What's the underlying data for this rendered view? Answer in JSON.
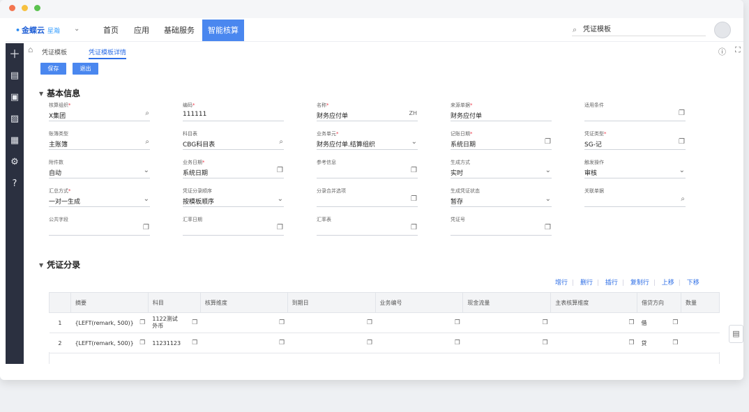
{
  "topnav": {
    "logo_mark": "•",
    "logo_text": "金蝶云",
    "logo_sub": "星瀚",
    "chevron": "⌄",
    "items": [
      "首页",
      "应用",
      "基础服务",
      "智能核算"
    ],
    "search_value": "凭证模板"
  },
  "breadcrumb": {
    "home": "⌂",
    "items": [
      "凭证模板",
      "凭证模板详情"
    ]
  },
  "toolbar": {
    "save": "保存",
    "exit": "退出"
  },
  "basic": {
    "title": "基本信息",
    "fields": [
      {
        "label": "核算组织",
        "req": "*",
        "value": "X集团",
        "icon": "⌕"
      },
      {
        "label": "编码",
        "req": "*",
        "value": "111111",
        "icon": ""
      },
      {
        "label": "名称",
        "req": "*",
        "value": "财务应付单",
        "icon": "ZH"
      },
      {
        "label": "来源单据",
        "req": "*",
        "value": "财务应付单",
        "icon": ""
      },
      {
        "label": "适用条件",
        "req": "",
        "value": "",
        "icon": "❐"
      },
      {
        "label": "账簿类型",
        "req": "",
        "value": "主账簿",
        "icon": "⌕"
      },
      {
        "label": "科目表",
        "req": "",
        "value": "CBG科目表",
        "icon": "⌕"
      },
      {
        "label": "业务单元",
        "req": "*",
        "value": "财务应付单.结算组织",
        "icon": "⌄"
      },
      {
        "label": "记账日期",
        "req": "*",
        "value": "系统日期",
        "icon": "❐"
      },
      {
        "label": "凭证类型",
        "req": "*",
        "value": "SG-记",
        "icon": "❐"
      },
      {
        "label": "附件数",
        "req": "",
        "value": "自动",
        "icon": "⌄"
      },
      {
        "label": "业务日期",
        "req": "*",
        "value": "系统日期",
        "icon": "❐"
      },
      {
        "label": "参考信息",
        "req": "",
        "value": "",
        "icon": "❐"
      },
      {
        "label": "生成方式",
        "req": "",
        "value": "实时",
        "icon": "⌄"
      },
      {
        "label": "触发操作",
        "req": "",
        "value": "审核",
        "icon": "⌄"
      },
      {
        "label": "汇总方式",
        "req": "*",
        "value": "一对一生成",
        "icon": "⌄"
      },
      {
        "label": "凭证分录顺序",
        "req": "",
        "value": "按模板顺序",
        "icon": "⌄"
      },
      {
        "label": "分录合并选项",
        "req": "",
        "value": "",
        "icon": "❐"
      },
      {
        "label": "生成凭证状态",
        "req": "",
        "value": "暂存",
        "icon": "⌄"
      },
      {
        "label": "关联单据",
        "req": "",
        "value": "",
        "icon": "⌕"
      },
      {
        "label": "公共字段",
        "req": "",
        "value": "",
        "icon": "❐"
      },
      {
        "label": "汇率日期",
        "req": "",
        "value": "",
        "icon": "❐"
      },
      {
        "label": "汇率表",
        "req": "",
        "value": "",
        "icon": "❐"
      },
      {
        "label": "凭证号",
        "req": "",
        "value": "",
        "icon": "❐"
      }
    ]
  },
  "entries": {
    "title": "凭证分录",
    "actions": [
      "增行",
      "删行",
      "插行",
      "复制行",
      "上移",
      "下移"
    ],
    "columns": [
      "",
      "摘要",
      "科目",
      "核算维度",
      "到期日",
      "业务编号",
      "现金流量",
      "主表核算维度",
      "借贷方向",
      "数量"
    ],
    "rows": [
      {
        "no": "1",
        "summary": "{LEFT(remark, 500)}",
        "account": "1122测试外币",
        "direction": "借"
      },
      {
        "no": "2",
        "summary": "{LEFT(remark, 500)}",
        "account": "11231123",
        "direction": "贷"
      }
    ]
  },
  "leftbar_icons": [
    "＋",
    "▤",
    "▣",
    "▨",
    "▦",
    "⚙",
    "?"
  ],
  "colors": {
    "accent": "#4a87ef",
    "leftbar": "#2b3040",
    "link": "#2d6ee6"
  }
}
